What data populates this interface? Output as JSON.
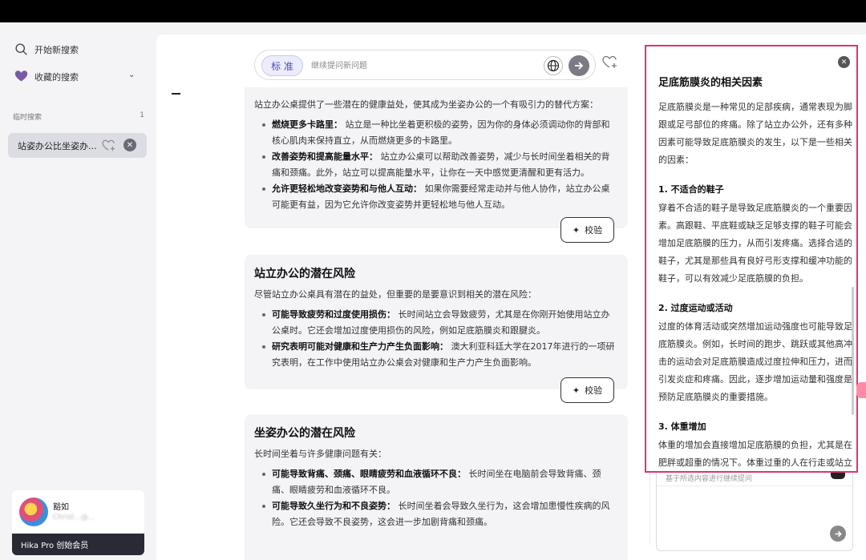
{
  "sidebar": {
    "new_search": "开始新搜索",
    "favorites": "收藏的搜索",
    "history_header": "临时搜索",
    "history_count": "1",
    "history_item": "站姿办公比坐姿办...",
    "user_name": "豁如",
    "user_email": "Christ...@...",
    "membership": "Hika Pro 创始会员"
  },
  "search": {
    "mode": "标 准",
    "placeholder": "继续提问新问题"
  },
  "card1": {
    "intro": "站立办公桌提供了一些潜在的健康益处，使其成为坐姿办公的一个有吸引力的替代方案：",
    "items": [
      {
        "bold": "燃烧更多卡路里：",
        "text": " 站立是一种比坐着更积极的姿势，因为你的身体必须调动你的背部和核心肌肉来保持直立，从而燃烧更多的卡路里。"
      },
      {
        "bold": "改善姿势和提高能量水平：",
        "text": " 站立办公桌可以帮助改善姿势，减少与长时间坐着相关的背痛和颈痛。此外，站立可以提高能量水平，让你在一天中感觉更清醒和更有活力。"
      },
      {
        "bold": "允许更轻松地改变姿势和与他人互动：",
        "text": " 如果你需要经常走动并与他人协作，站立办公桌可能更有益，因为它允许你改变姿势并更轻松地与他人互动。"
      }
    ],
    "verify": "校验"
  },
  "card2": {
    "title": "站立办公的潜在风险",
    "intro": "尽管站立办公桌具有潜在的益处，但重要的是要意识到相关的潜在风险：",
    "items": [
      {
        "bold": "可能导致疲劳和过度使用损伤：",
        "text": " 长时间站立会导致疲劳，尤其是在你刚开始使用站立办公桌时。它还会增加过度使用损伤的风险，例如足底筋膜炎和跟腱炎。"
      },
      {
        "bold": "研究表明可能对健康和生产力产生负面影响：",
        "text": " 澳大利亚科廷大学在2017年进行的一项研究表明，在工作中使用站立办公桌会对健康和生产力产生负面影响。"
      }
    ],
    "verify": "校验"
  },
  "card3": {
    "title": "坐姿办公的潜在风险",
    "intro": "长时间坐着与许多健康问题有关：",
    "items": [
      {
        "bold": "可能导致背痛、颈痛、眼睛疲劳和血液循环不良：",
        "text": " 长时间坐在电脑前会导致背痛、颈痛、眼睛疲劳和血液循环不良。"
      },
      {
        "bold": "可能导致久坐行为和不良姿势：",
        "text": " 长时间坐着会导致久坐行为，这会增加患慢性疾病的风险。它还会导致不良姿势，这会进一步加剧背痛和颈痛。"
      }
    ]
  },
  "rpanel": {
    "title": "足底筋膜炎的相关因素",
    "intro": "足底筋膜炎是一种常见的足部疾病，通常表现为脚跟或足弓部位的疼痛。除了站立办公外，还有多种因素可能导致足底筋膜炎的发生，以下是一些相关的因素：",
    "s1_title": "1. 不适合的鞋子",
    "s1_text": "穿着不合适的鞋子是导致足底筋膜炎的一个重要因素。高跟鞋、平底鞋或缺乏足够支撑的鞋子可能会增加足底筋膜的压力，从而引发疼痛。选择合适的鞋子，尤其是那些具有良好弓形支撑和缓冲功能的鞋子，可以有效减少足底筋膜的负担。",
    "s2_title": "2. 过度运动或活动",
    "s2_text": "过度的体育活动或突然增加运动强度也可能导致足底筋膜炎。例如，长时间的跑步、跳跃或其他高冲击的运动会对足底筋膜造成过度拉伸和压力，进而引发炎症和疼痛。因此，逐步增加运动量和强度是预防足底筋膜炎的重要措施。",
    "s3_title": "3. 体重增加",
    "s3_text": "体重的增加会直接增加足底筋膜的负担，尤其是在肥胖或超重的情况下。体重过重的人在行走或站立时，足底筋膜承受的压力会显著增加，从而"
  },
  "followup": {
    "hint": "基于所选内容进行继续提问"
  }
}
